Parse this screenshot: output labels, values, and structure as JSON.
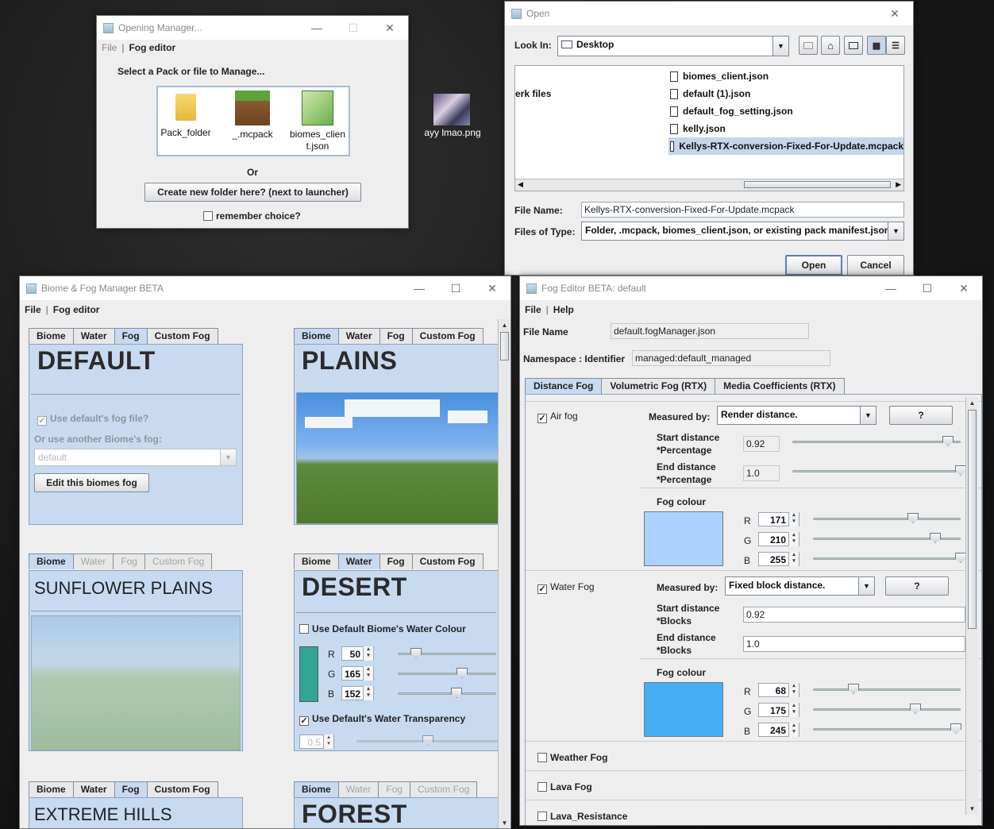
{
  "desktop": {
    "icon_label": "ayy lmao.png"
  },
  "opening_manager": {
    "title": "Opening Manager...",
    "menu": [
      "File",
      "Fog editor"
    ],
    "prompt": "Select a Pack or file to Manage...",
    "files": [
      {
        "label": "Pack_folder",
        "icon": "folder-icon"
      },
      {
        "label": "_.mcpack",
        "icon": "grass-block-icon"
      },
      {
        "label": "biomes_client.json",
        "icon": "notepad-icon"
      }
    ],
    "or_label": "Or",
    "create_button": "Create new folder here? (next to launcher)",
    "remember_label": "remember choice?"
  },
  "open_dialog": {
    "title": "Open",
    "look_in_label": "Look In:",
    "look_in_value": "Desktop",
    "left_item": "erk files",
    "files": [
      "biomes_client.json",
      "default (1).json",
      "default_fog_setting.json",
      "kelly.json",
      "Kellys-RTX-conversion-Fixed-For-Update.mcpack"
    ],
    "selected_index": 4,
    "file_name_label": "File Name:",
    "file_name_value": "Kellys-RTX-conversion-Fixed-For-Update.mcpack",
    "files_of_type_label": "Files of Type:",
    "files_of_type_value": "Folder, .mcpack, biomes_client.json, or existing pack manifest.json",
    "open_button": "Open",
    "cancel_button": "Cancel"
  },
  "biome_manager": {
    "title": "Biome & Fog Manager BETA",
    "menu": [
      "File",
      "Fog editor"
    ],
    "tab_labels": [
      "Biome",
      "Water",
      "Fog",
      "Custom Fog"
    ],
    "default_panel": {
      "title": "DEFAULT",
      "use_default_fog": "Use default's fog file?",
      "other_biome_label": "Or use another Biome's fog:",
      "combo_value": "default",
      "edit_button": "Edit this biomes fog"
    },
    "plains_panel": {
      "title": "PLAINS"
    },
    "sunflower_panel": {
      "title": "SUNFLOWER PLAINS"
    },
    "desert_panel": {
      "title": "DESERT",
      "use_water_colour": "Use Default Biome's Water Colour",
      "r": "50",
      "g": "165",
      "b": "152",
      "r_label": "R",
      "g_label": "G",
      "b_label": "B",
      "swatch_color": "#32a598",
      "use_transparency": "Use Default's Water Transparency",
      "transparency_value": "0.5"
    },
    "extreme_hills_panel": {
      "title": "EXTREME HILLS"
    },
    "forest_panel": {
      "title": "FOREST"
    }
  },
  "fog_editor": {
    "title": "Fog Editor BETA: default",
    "menu": [
      "File",
      "Help"
    ],
    "file_name_label": "File Name",
    "file_name_value": "default.fogManager.json",
    "namespace_label": "Namespace : Identifier",
    "namespace_value": "managed:default_managed",
    "tabs": [
      "Distance Fog",
      "Volumetric Fog (RTX)",
      "Media Coefficients (RTX)"
    ],
    "air_fog": {
      "label": "Air fog",
      "measured_by_label": "Measured by:",
      "measured_by_value": "Render distance.",
      "help_button": "?",
      "start_label_1": "Start distance",
      "start_label_2": "*Percentage",
      "start_value": "0.92",
      "end_label_1": "End distance",
      "end_label_2": "*Percentage",
      "end_value": "1.0",
      "colour_label": "Fog colour",
      "r": "171",
      "g": "210",
      "b": "255",
      "swatch_color": "#abd2ff"
    },
    "water_fog": {
      "label": "Water Fog",
      "measured_by_label": "Measured by:",
      "measured_by_value": "Fixed block distance.",
      "help_button": "?",
      "start_label_1": "Start distance",
      "start_label_2": "*Blocks",
      "start_value": "0.92",
      "end_label_1": "End distance",
      "end_label_2": "*Blocks",
      "end_value": "1.0",
      "colour_label": "Fog colour",
      "r": "68",
      "g": "175",
      "b": "245",
      "swatch_color": "#44aff5"
    },
    "weather_fog": "Weather Fog",
    "lava_fog": "Lava Fog",
    "lava_resistance": "Lava_Resistance"
  }
}
